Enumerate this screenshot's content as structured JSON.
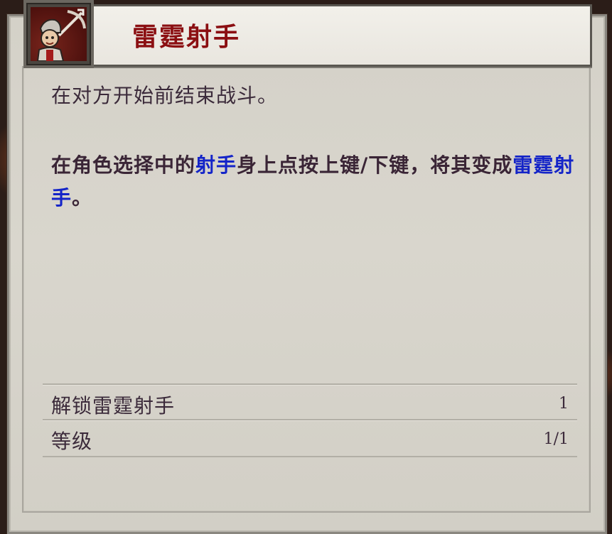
{
  "title": "雷霆射手",
  "description": {
    "line1": "在对方开始前结束战斗。",
    "line2_parts": [
      "在角色选择中的",
      "射手",
      "身上点按上键/下键，将其变成",
      "雷霆射手",
      "。"
    ]
  },
  "stats": [
    {
      "label": "解锁雷霆射手",
      "value": "1"
    },
    {
      "label": "等级",
      "value": "1/1"
    }
  ],
  "colors": {
    "title": "#8b0f12",
    "highlight": "#1424c8",
    "text": "#3b2a3a"
  },
  "icons": {
    "portrait": "crossbow-archer-portrait-icon"
  }
}
